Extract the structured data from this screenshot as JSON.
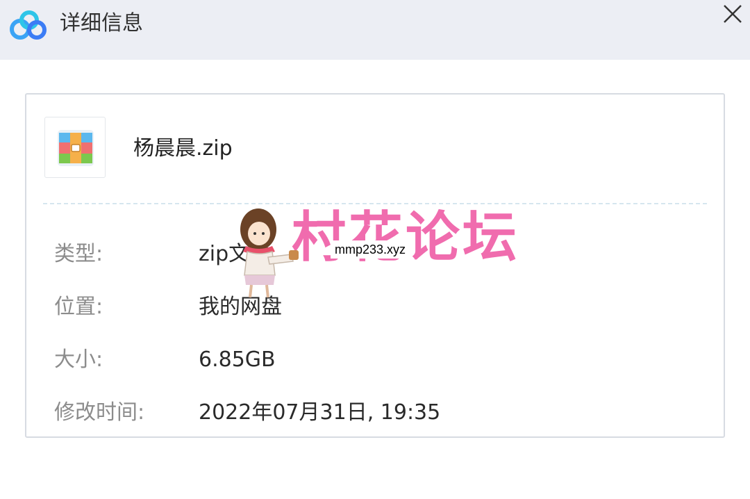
{
  "window": {
    "title": "详细信息",
    "logo_icon": "baidu-netdisk-cloud-icon",
    "close_icon": "close-icon"
  },
  "file": {
    "name": "杨晨晨.zip",
    "icon": "zip-archive-icon"
  },
  "details": [
    {
      "label": "类型:",
      "value": "zip文件"
    },
    {
      "label": "位置:",
      "value": "我的网盘"
    },
    {
      "label": "大小:",
      "value": "6.85GB"
    },
    {
      "label": "修改时间:",
      "value": "2022年07月31日, 19:35"
    }
  ],
  "watermark": {
    "text": "村花论坛",
    "url": "mmp233.xyz",
    "color": "#f06cae"
  },
  "colors": {
    "titlebar_bg": "#eceef4",
    "label": "#8c8c8c",
    "value": "#2a2a2a",
    "divider": "#d6e6ef"
  }
}
